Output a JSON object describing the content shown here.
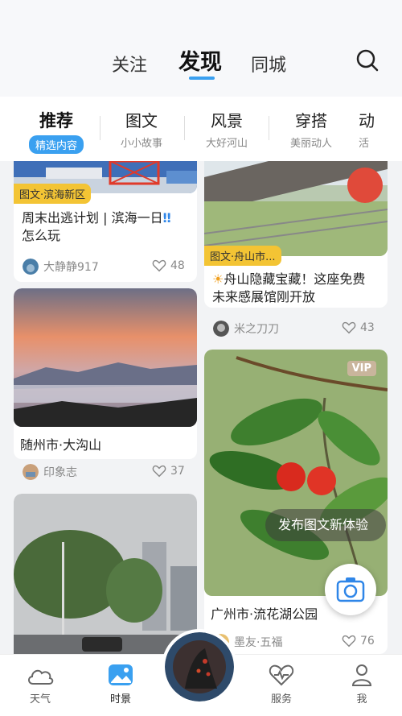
{
  "header": {
    "tabs": [
      {
        "label": "关注"
      },
      {
        "label": "发现"
      },
      {
        "label": "同城"
      }
    ],
    "active_tab": "发现",
    "accent_color": "#3aa0f0"
  },
  "subtabs": [
    {
      "label": "推荐",
      "sub": "精选内容"
    },
    {
      "label": "图文",
      "sub": "小小故事"
    },
    {
      "label": "风景",
      "sub": "大好河山"
    },
    {
      "label": "穿搭",
      "sub": "美丽动人"
    },
    {
      "label": "动",
      "sub": "活"
    }
  ],
  "cards": [
    {
      "tag": "图文·滨海新区",
      "title_line1": "周末出逃计划 | 滨海一日",
      "title_mark": "‼",
      "title_line2": "怎么玩",
      "author": "大静静917",
      "likes": "48"
    },
    {
      "tag": "图文·舟山市...",
      "title_icon": "☀",
      "title_line1": "舟山隐藏宝藏！这座免费",
      "title_line2": "未来感展馆刚开放",
      "author": "米之刀刀",
      "likes": "43"
    },
    {
      "title_line1": "随州市·大沟山",
      "author": "印象志",
      "likes": "37"
    },
    {
      "vip": "VIP",
      "title_line1": "广州市·流花湖公园",
      "author": "墨友·五福",
      "likes": "76"
    },
    {
      "title_line1": ""
    }
  ],
  "floating": {
    "publish_hint": "发布图文新体验"
  },
  "bottom_nav": [
    {
      "label": "天气",
      "icon": "cloud-icon"
    },
    {
      "label": "时景",
      "icon": "photo-icon"
    },
    {
      "label": "",
      "icon": "center-photo"
    },
    {
      "label": "服务",
      "icon": "heart-pulse-icon"
    },
    {
      "label": "我",
      "icon": "person-icon"
    }
  ]
}
